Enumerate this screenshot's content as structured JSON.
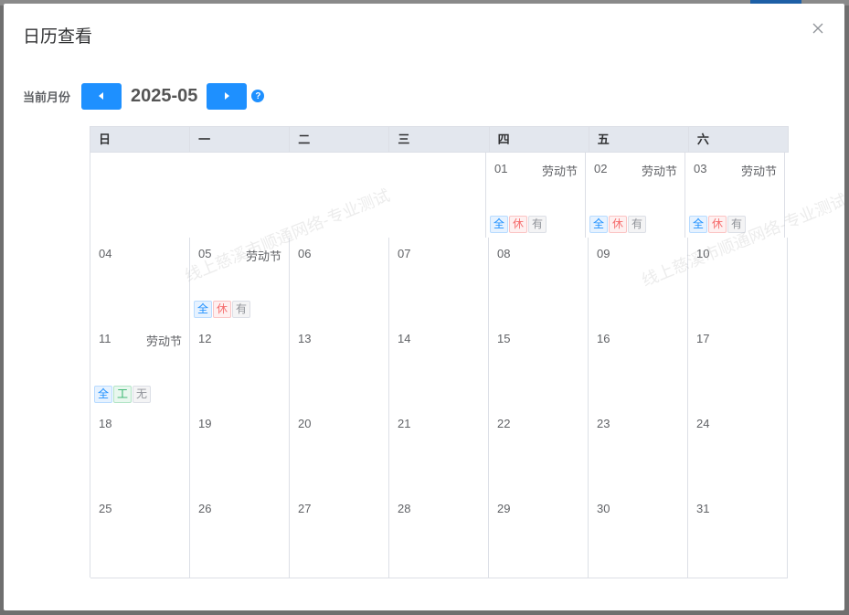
{
  "dialog": {
    "title": "日历查看",
    "close_icon": "close-icon"
  },
  "toolbar": {
    "month_label": "当前月份",
    "month_value": "2025-05",
    "prev_icon": "caret-left-icon",
    "next_icon": "caret-right-icon",
    "help_text": "?"
  },
  "colors": {
    "accent": "#1e90ff",
    "header_bg": "#e3e7ee",
    "rest": "#f56c6c",
    "work": "#2fb36a"
  },
  "calendar": {
    "weekdays": [
      "日",
      "一",
      "二",
      "三",
      "四",
      "五",
      "六"
    ],
    "days": {
      "d01": {
        "num": "01",
        "holiday": "劳动节",
        "tags": [
          "全",
          "休",
          "有"
        ]
      },
      "d02": {
        "num": "02",
        "holiday": "劳动节",
        "tags": [
          "全",
          "休",
          "有"
        ]
      },
      "d03": {
        "num": "03",
        "holiday": "劳动节",
        "tags": [
          "全",
          "休",
          "有"
        ]
      },
      "d04": {
        "num": "04"
      },
      "d05": {
        "num": "05",
        "holiday": "劳动节",
        "tags": [
          "全",
          "休",
          "有"
        ]
      },
      "d06": {
        "num": "06"
      },
      "d07": {
        "num": "07"
      },
      "d08": {
        "num": "08"
      },
      "d09": {
        "num": "09"
      },
      "d10": {
        "num": "10"
      },
      "d11": {
        "num": "11",
        "holiday": "劳动节",
        "tags": [
          "全",
          "工",
          "无"
        ]
      },
      "d12": {
        "num": "12"
      },
      "d13": {
        "num": "13"
      },
      "d14": {
        "num": "14"
      },
      "d15": {
        "num": "15"
      },
      "d16": {
        "num": "16"
      },
      "d17": {
        "num": "17"
      },
      "d18": {
        "num": "18"
      },
      "d19": {
        "num": "19"
      },
      "d20": {
        "num": "20"
      },
      "d21": {
        "num": "21"
      },
      "d22": {
        "num": "22"
      },
      "d23": {
        "num": "23"
      },
      "d24": {
        "num": "24"
      },
      "d25": {
        "num": "25"
      },
      "d26": {
        "num": "26"
      },
      "d27": {
        "num": "27"
      },
      "d28": {
        "num": "28"
      },
      "d29": {
        "num": "29"
      },
      "d30": {
        "num": "30"
      },
      "d31": {
        "num": "31"
      }
    }
  },
  "watermark": {
    "text_1": "线上慈溪市顺通网络-专业测试",
    "text_2": "线上慈溪市顺通网络-专业测试"
  }
}
